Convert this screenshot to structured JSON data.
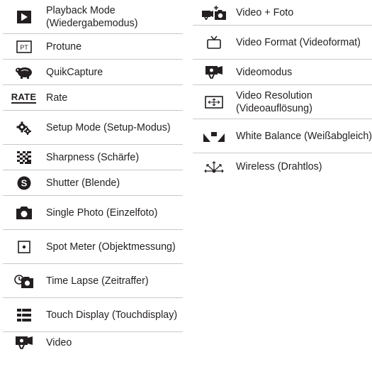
{
  "left_column": [
    {
      "icon": "playback-mode-icon",
      "label": "Playback Mode (Wiedergabemodus)"
    },
    {
      "icon": "protune-icon",
      "label": "Protune",
      "icon_text": "PT"
    },
    {
      "icon": "quikcapture-icon",
      "label": "QuikCapture"
    },
    {
      "icon": "rate-icon",
      "label": "Rate",
      "icon_text": "RATE"
    },
    {
      "icon": "setup-mode-icon",
      "label": "Setup Mode (Setup-Modus)"
    },
    {
      "icon": "sharpness-icon",
      "label": "Sharpness (Schärfe)"
    },
    {
      "icon": "shutter-icon",
      "label": "Shutter (Blende)",
      "icon_text": "S"
    },
    {
      "icon": "single-photo-icon",
      "label": "Single Photo (Einzelfoto)"
    },
    {
      "icon": "spot-meter-icon",
      "label": "Spot Meter (Objektmessung)"
    },
    {
      "icon": "time-lapse-icon",
      "label": "Time Lapse (Zeitraffer)"
    },
    {
      "icon": "touch-display-icon",
      "label": "Touch Display (Touchdisplay)"
    },
    {
      "icon": "video-icon",
      "label": "Video"
    }
  ],
  "right_column": [
    {
      "icon": "video-plus-photo-icon",
      "label": "Video + Foto"
    },
    {
      "icon": "video-format-icon",
      "label": "Video Format (Videoformat)"
    },
    {
      "icon": "video-mode-icon",
      "label": "Videomodus"
    },
    {
      "icon": "video-resolution-icon",
      "label": "Video Resolution (Videoauflösung)"
    },
    {
      "icon": "white-balance-icon",
      "label": "White Balance (Weißabgleich)"
    },
    {
      "icon": "wireless-icon",
      "label": "Wireless (Drahtlos)"
    }
  ],
  "colors": {
    "text": "#231f20",
    "divider": "#c9c9c9"
  }
}
